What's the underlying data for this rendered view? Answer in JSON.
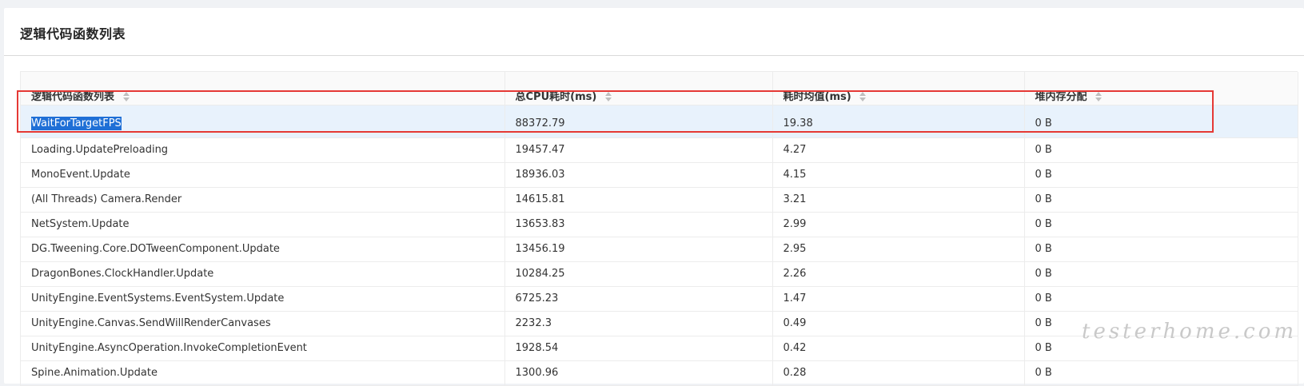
{
  "card": {
    "title": "逻辑代码函数列表"
  },
  "table": {
    "columns": [
      "逻辑代码函数列表",
      "总CPU耗时(ms)",
      "耗时均值(ms)",
      "堆内存分配"
    ],
    "rows": [
      {
        "name": "WaitForTargetFPS",
        "total": "88372.79",
        "avg": "19.38",
        "heap": "0 B"
      },
      {
        "name": "Loading.UpdatePreloading",
        "total": "19457.47",
        "avg": "4.27",
        "heap": "0 B"
      },
      {
        "name": "MonoEvent.Update",
        "total": "18936.03",
        "avg": "4.15",
        "heap": "0 B"
      },
      {
        "name": "(All Threads) Camera.Render",
        "total": "14615.81",
        "avg": "3.21",
        "heap": "0 B"
      },
      {
        "name": "NetSystem.Update",
        "total": "13653.83",
        "avg": "2.99",
        "heap": "0 B"
      },
      {
        "name": "DG.Tweening.Core.DOTweenComponent.Update",
        "total": "13456.19",
        "avg": "2.95",
        "heap": "0 B"
      },
      {
        "name": "DragonBones.ClockHandler.Update",
        "total": "10284.25",
        "avg": "2.26",
        "heap": "0 B"
      },
      {
        "name": "UnityEngine.EventSystems.EventSystem.Update",
        "total": "6725.23",
        "avg": "1.47",
        "heap": "0 B"
      },
      {
        "name": "UnityEngine.Canvas.SendWillRenderCanvases",
        "total": "2232.3",
        "avg": "0.49",
        "heap": "0 B"
      },
      {
        "name": "UnityEngine.AsyncOperation.InvokeCompletionEvent",
        "total": "1928.54",
        "avg": "0.42",
        "heap": "0 B"
      },
      {
        "name": "Spine.Animation.Update",
        "total": "1300.96",
        "avg": "0.28",
        "heap": "0 B"
      }
    ]
  },
  "watermark": "testerhome.com",
  "colors": {
    "highlight_border": "#e53935",
    "selected_row_bg": "#e8f2fc",
    "text_selection_bg": "#1f6fd6"
  }
}
